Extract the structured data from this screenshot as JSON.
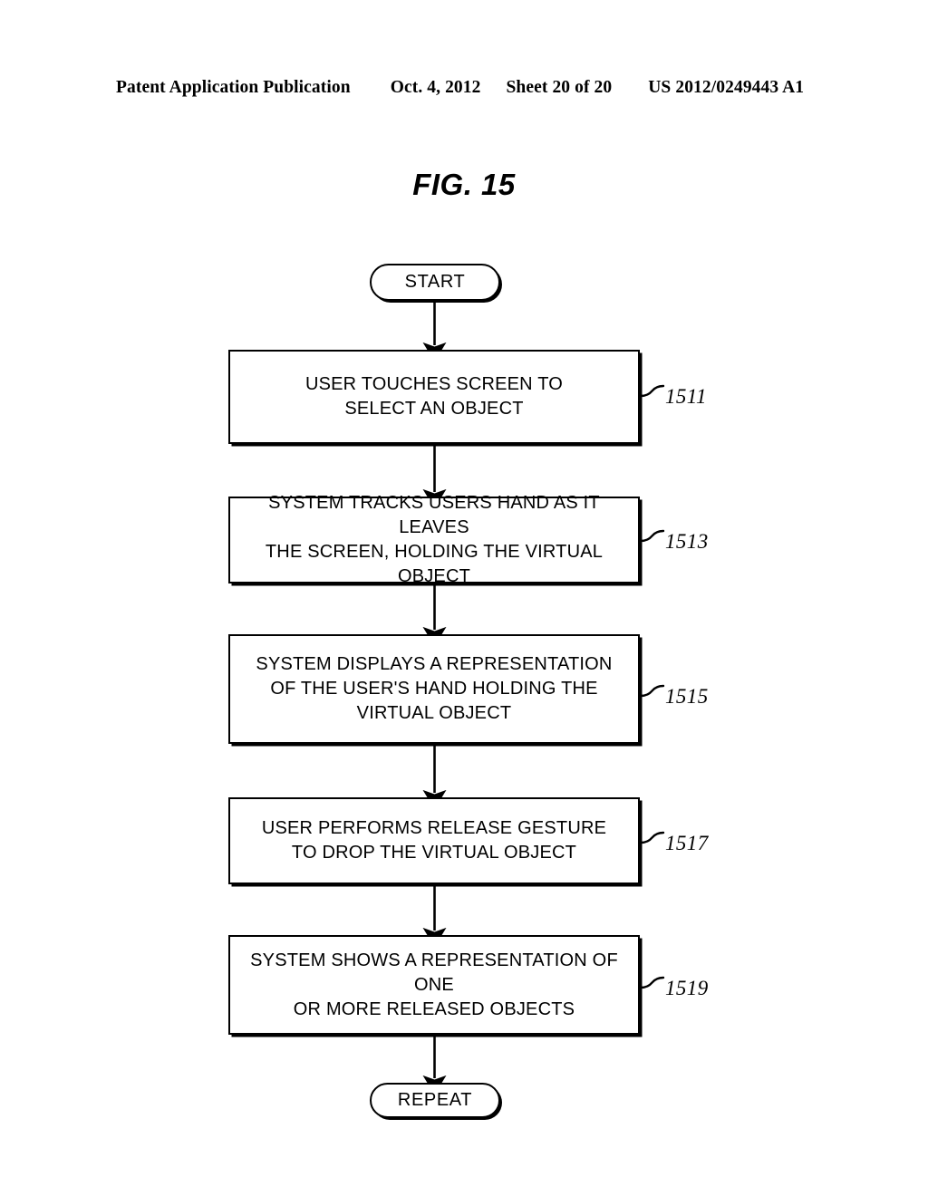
{
  "header": {
    "publication": "Patent Application Publication",
    "date": "Oct. 4, 2012",
    "sheet": "Sheet 20 of 20",
    "patent_number": "US 2012/0249443 A1"
  },
  "figure": {
    "title": "FIG. 15"
  },
  "flowchart": {
    "start": {
      "label": "START"
    },
    "end": {
      "label": "REPEAT"
    },
    "steps": [
      {
        "ref": "1511",
        "text": "USER TOUCHES SCREEN TO\nSELECT AN OBJECT"
      },
      {
        "ref": "1513",
        "text": "SYSTEM TRACKS USERS HAND AS IT LEAVES\nTHE SCREEN, HOLDING THE VIRTUAL OBJECT"
      },
      {
        "ref": "1515",
        "text": "SYSTEM DISPLAYS A REPRESENTATION\nOF THE USER'S HAND HOLDING THE\nVIRTUAL OBJECT"
      },
      {
        "ref": "1517",
        "text": "USER PERFORMS RELEASE GESTURE\nTO DROP THE VIRTUAL OBJECT"
      },
      {
        "ref": "1519",
        "text": "SYSTEM SHOWS A REPRESENTATION OF ONE\nOR MORE RELEASED OBJECTS"
      }
    ]
  },
  "colors": {
    "ink": "#000000",
    "paper": "#ffffff"
  }
}
